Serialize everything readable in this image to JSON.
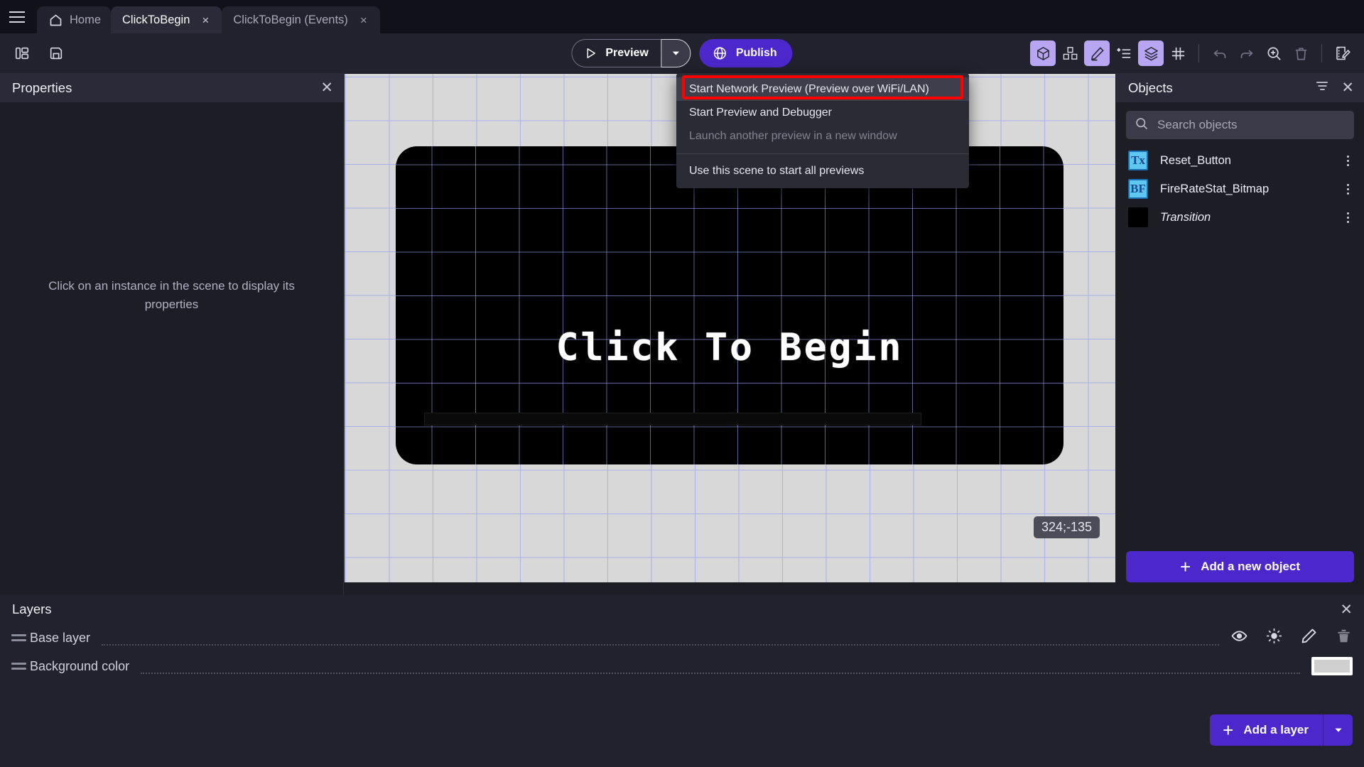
{
  "tabs": [
    {
      "label": "Home",
      "icon": "home-icon",
      "active": false,
      "closable": false
    },
    {
      "label": "ClickToBegin",
      "active": true,
      "closable": true,
      "close": "×"
    },
    {
      "label": "ClickToBegin (Events)",
      "active": false,
      "closable": true,
      "close": "×"
    }
  ],
  "toolbar": {
    "left_icons": [
      "panel-layout-icon",
      "save-icon"
    ],
    "preview_label": "Preview",
    "preview_dropdown_icon": "chevron-down-icon",
    "publish_label": "Publish",
    "right_icons": [
      "object-3d-icon",
      "objects-group-icon",
      "edit-pencil-icon",
      "instances-list-icon",
      "layers-icon",
      "grid-icon",
      "undo-icon",
      "redo-icon",
      "zoom-in-icon",
      "trash-icon",
      "edit-scene-icon"
    ]
  },
  "preview_menu": {
    "items": [
      {
        "label": "Start Network Preview (Preview over WiFi/LAN)",
        "state": "hovered",
        "highlighted": true
      },
      {
        "label": "Start Preview and Debugger",
        "state": "normal",
        "highlighted": false
      },
      {
        "label": "Launch another preview in a new window",
        "state": "disabled",
        "highlighted": false
      }
    ],
    "footer_item": {
      "label": "Use this scene to start all previews",
      "state": "normal"
    },
    "highlight_color": "#ff0000"
  },
  "properties": {
    "title": "Properties",
    "close_icon": "close-icon",
    "empty_message": "Click on an instance in the scene to display its properties"
  },
  "canvas": {
    "scene_title": "Click To Begin",
    "coordinates": "324;-135",
    "background_color": "#d8d8d8",
    "grid_color": "#aab0e8",
    "game_color": "#000000"
  },
  "objects": {
    "title": "Objects",
    "filter_icon": "filter-icon",
    "close_icon": "close-icon",
    "search": {
      "placeholder": "Search objects",
      "value": "",
      "icon": "search-icon"
    },
    "items": [
      {
        "name": "Reset_Button",
        "thumb": "text-object-icon",
        "thumb_text": "Tx",
        "italic": false,
        "menu_icon": "more-vertical-icon"
      },
      {
        "name": "FireRateStat_Bitmap",
        "thumb": "bitmap-text-object-icon",
        "thumb_text": "BF",
        "italic": false,
        "menu_icon": "more-vertical-icon"
      },
      {
        "name": "Transition",
        "thumb": "black-sprite-icon",
        "thumb_text": "",
        "italic": true,
        "menu_icon": "more-vertical-icon"
      }
    ],
    "add_button": {
      "label": "Add a new object",
      "icon": "plus-icon"
    }
  },
  "layers": {
    "title": "Layers",
    "close_icon": "close-icon",
    "rows": [
      {
        "name": "Base layer",
        "handle": "drag-handle-icon",
        "actions": [
          "eye-icon",
          "lighting-icon",
          "edit-pencil-icon",
          "trash-icon"
        ]
      },
      {
        "name": "Background color",
        "handle": "drag-handle-icon",
        "actions": [
          "color-swatch"
        ],
        "swatch_color": "#d0d0d0"
      }
    ],
    "add_button": {
      "label": "Add a layer",
      "icon": "plus-icon",
      "dropdown_icon": "chevron-down-icon"
    }
  },
  "theme": {
    "accent": "#4c28cc",
    "panel_bg": "#1d1d26",
    "header_bg": "#2a2a38",
    "selected_icon_bg": "#b8a6f2"
  }
}
